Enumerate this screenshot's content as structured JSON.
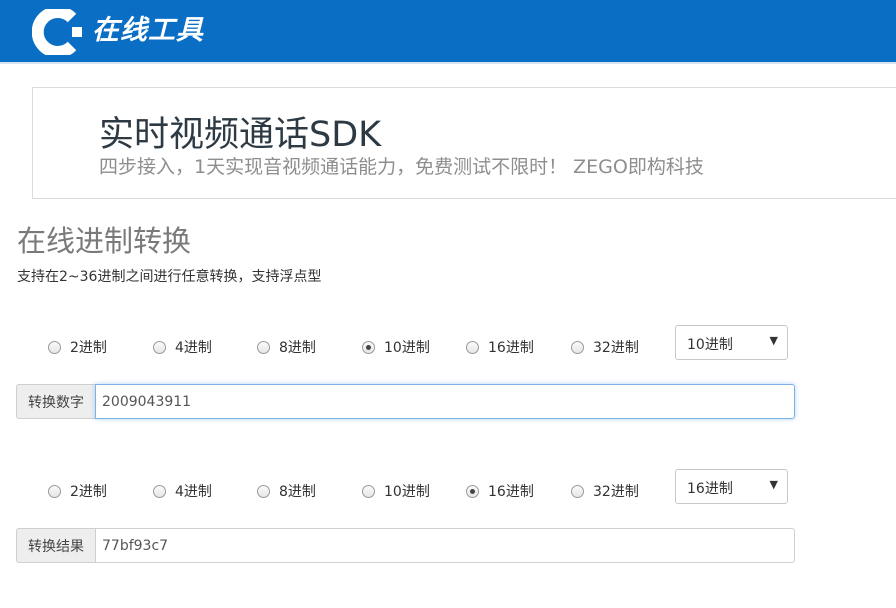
{
  "header": {
    "brand": "在线工具",
    "bg_color": "#0a6fc4",
    "logo_icon": "c-logo-icon"
  },
  "ad": {
    "title": "实时视频通话SDK",
    "subtitle": "四步接入，1天实现音视频通话能力，免费测试不限时！ ZEGO即构科技"
  },
  "page": {
    "title": "在线进制转换",
    "description": "支持在2~36进制之间进行任意转换，支持浮点型"
  },
  "input_section": {
    "radios": [
      {
        "label": "2进制",
        "checked": false
      },
      {
        "label": "4进制",
        "checked": false
      },
      {
        "label": "8进制",
        "checked": false
      },
      {
        "label": "10进制",
        "checked": true
      },
      {
        "label": "16进制",
        "checked": false
      },
      {
        "label": "32进制",
        "checked": false
      }
    ],
    "select_value": "10进制",
    "addon_label": "转换数字",
    "value": "2009043911"
  },
  "output_section": {
    "radios": [
      {
        "label": "2进制",
        "checked": false
      },
      {
        "label": "4进制",
        "checked": false
      },
      {
        "label": "8进制",
        "checked": false
      },
      {
        "label": "10进制",
        "checked": false
      },
      {
        "label": "16进制",
        "checked": true
      },
      {
        "label": "32进制",
        "checked": false
      }
    ],
    "select_value": "16进制",
    "addon_label": "转换结果",
    "value": "77bf93c7"
  }
}
